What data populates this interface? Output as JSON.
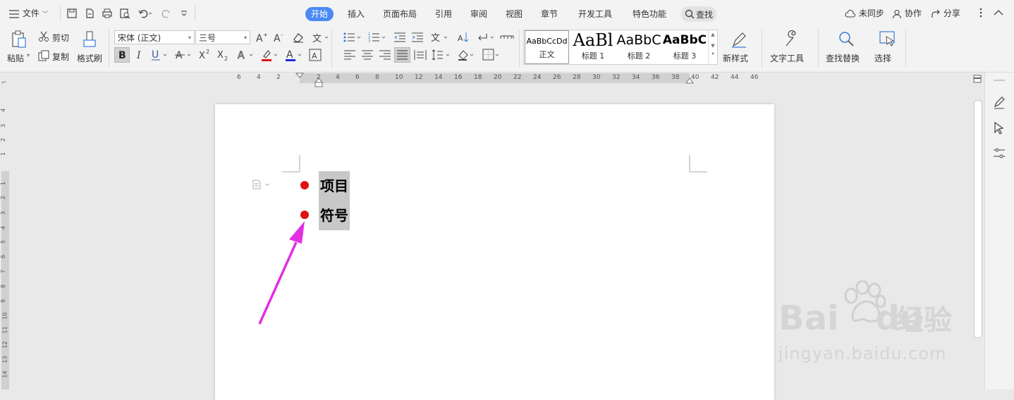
{
  "menu": {
    "file_label": "文件"
  },
  "tabs": [
    {
      "label": "开始",
      "active": true
    },
    {
      "label": "插入"
    },
    {
      "label": "页面布局"
    },
    {
      "label": "引用"
    },
    {
      "label": "审阅"
    },
    {
      "label": "视图"
    },
    {
      "label": "章节"
    },
    {
      "label": "开发工具"
    },
    {
      "label": "特色功能"
    }
  ],
  "search_label": "查找",
  "status": {
    "sync": "未同步",
    "collab": "协作",
    "share": "分享"
  },
  "ribbon": {
    "paste": "粘贴",
    "cut": "剪切",
    "copy": "复制",
    "format_painter": "格式刷",
    "font_name": "宋体 (正文)",
    "font_size": "三号",
    "new_style": "新样式",
    "text_tools": "文字工具",
    "find_replace": "查找替换",
    "select": "选择"
  },
  "styles": [
    {
      "sample": "AaBbCcDd",
      "name": "正文"
    },
    {
      "sample": "AaBl",
      "name": "标题 1"
    },
    {
      "sample": "AaBbC",
      "name": "标题 2"
    },
    {
      "sample": "AaBbC",
      "name": "标题 3"
    }
  ],
  "ruler": {
    "top_ticks": [
      "6",
      "4",
      "2",
      "2",
      "4",
      "6",
      "8",
      "10",
      "12",
      "14",
      "16",
      "18",
      "20",
      "22",
      "24",
      "26",
      "28",
      "30",
      "32",
      "34",
      "36",
      "38",
      "40",
      "42",
      "44",
      "46"
    ],
    "left_ticks": [
      "4",
      "3",
      "2",
      "1",
      "1",
      "2",
      "3",
      "4",
      "5",
      "6",
      "7",
      "8",
      "9",
      "10",
      "11",
      "12",
      "13",
      "14"
    ]
  },
  "document": {
    "items": [
      "项目",
      "符号"
    ]
  },
  "colors": {
    "accent": "#4a8af4",
    "bullet": "#e01313",
    "arrow": "#e32ee3",
    "selection": "#c8c8c8"
  },
  "watermark": {
    "brand": "Bai",
    "brand2": "du",
    "cn": "经验",
    "url": "jingyan.baidu.com"
  }
}
